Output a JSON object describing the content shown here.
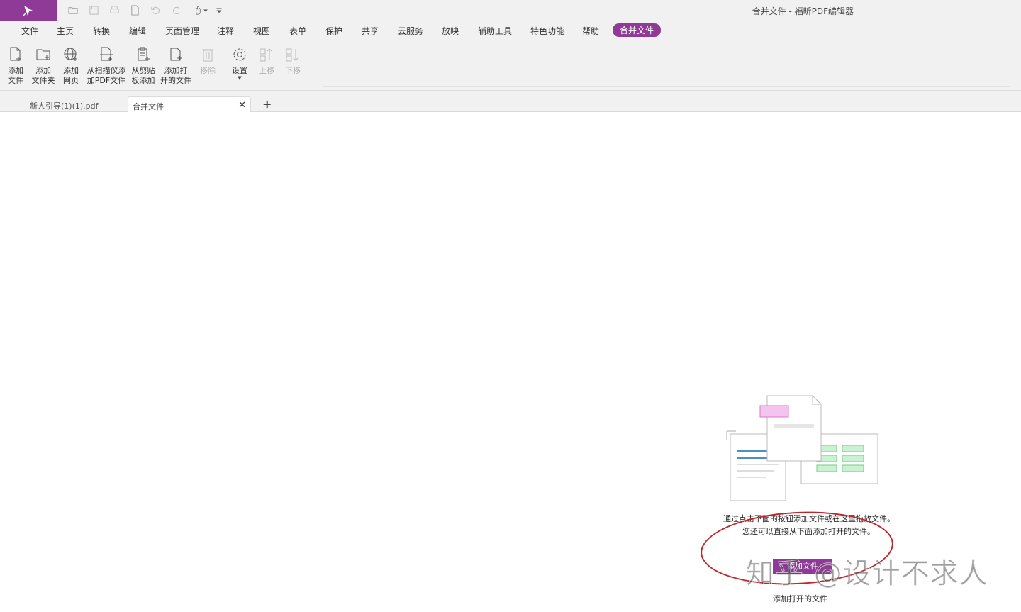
{
  "app": {
    "window_title": "合并文件 - 福昕PDF编辑器"
  },
  "menu": {
    "items": [
      "文件",
      "主页",
      "转换",
      "编辑",
      "页面管理",
      "注释",
      "视图",
      "表单",
      "保护",
      "共享",
      "云服务",
      "放映",
      "辅助工具",
      "特色功能",
      "帮助",
      "合并文件"
    ],
    "active": "合并文件"
  },
  "ribbon": {
    "add_file": "添加\n文件",
    "add_folder": "添加\n文件夹",
    "add_webpage": "添加\n网页",
    "add_from_scanner": "从扫描仪添\n加PDF文件",
    "add_from_clipboard": "从剪贴\n板添加",
    "add_open_files": "添加打\n开的文件",
    "remove": "移除",
    "settings": "设置",
    "move_up": "上移",
    "move_down": "下移"
  },
  "tabs": {
    "tab1": "新人引导(1)(1).pdf",
    "tab2": "合并文件"
  },
  "content": {
    "hint_line1": "通过点击下面的按钮添加文件或在这里拖放文件。",
    "hint_line2": "您还可以直接从下面添加打开的文件。",
    "add_files_button": "添加文件",
    "add_open_files_link": "添加打开的文件",
    "watermark": "知乎 @设计不求人"
  },
  "colors": {
    "accent": "#8e3a96",
    "annotation_circle": "#c0262a"
  }
}
